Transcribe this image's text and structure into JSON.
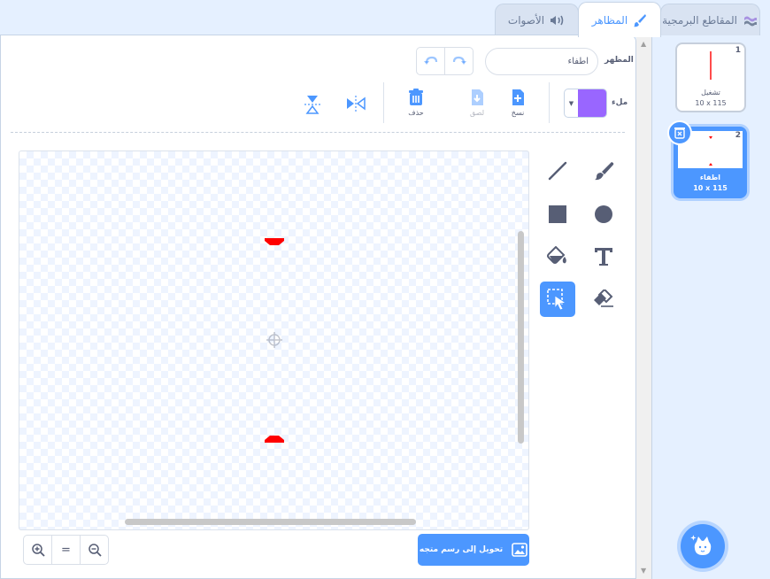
{
  "tabs": [
    {
      "label": "المقاطع البرمجية",
      "icon": "code-icon",
      "active": false
    },
    {
      "label": "المظاهر",
      "icon": "brush-icon",
      "active": true
    },
    {
      "label": "الأصوات",
      "icon": "sound-icon",
      "active": false
    }
  ],
  "costume_editor": {
    "costume_label": "المظهر",
    "costume_name": "اطفاء",
    "fill_label": "ملء",
    "fill_color": "#9966ff",
    "actions": {
      "copy": "نسخ",
      "paste": "لصق",
      "delete": "حذف"
    },
    "convert_button": "تحويل إلى رسم متجه",
    "zoom_reset": "="
  },
  "costumes": [
    {
      "number": "1",
      "name": "تشغيل",
      "size": "10 x 115"
    },
    {
      "number": "2",
      "name": "اطفاء",
      "size": "10 x 115"
    }
  ],
  "colors": {
    "accent": "#4c97ff",
    "shape": "#ff0000",
    "background": "#e5f0ff"
  }
}
